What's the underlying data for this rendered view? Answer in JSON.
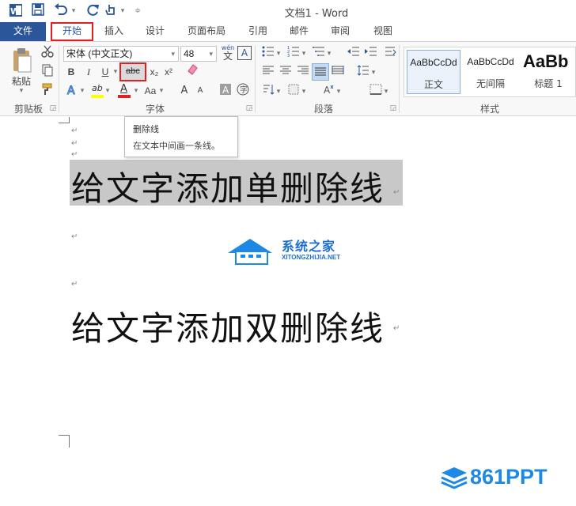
{
  "window": {
    "title": "文档1 - Word"
  },
  "quick_access": [
    "word-logo-icon",
    "save-icon",
    "undo-icon",
    "redo-icon",
    "touch-mode-icon",
    "customize-icon"
  ],
  "tabs": [
    "文件",
    "开始",
    "插入",
    "设计",
    "页面布局",
    "引用",
    "邮件",
    "审阅",
    "视图"
  ],
  "clipboard": {
    "paste_label": "粘贴",
    "group_label": "剪贴板"
  },
  "font": {
    "name": "宋体 (中文正文)",
    "size": "48",
    "wen_label": "wén",
    "wen_char": "文",
    "a_label": "A",
    "bold": "B",
    "italic": "I",
    "underline": "U",
    "strike": "abc",
    "sub": "x₂",
    "sup": "x²",
    "grow": "A",
    "shrink": "A",
    "case": "Aa",
    "ab": "ab",
    "font_color": "A",
    "group_label": "字体"
  },
  "paragraph": {
    "group_label": "段落"
  },
  "styles": {
    "items": [
      {
        "sample": "AaBbCcDd",
        "name": "正文"
      },
      {
        "sample": "AaBbCcDd",
        "name": "无间隔"
      },
      {
        "sample": "AaBb",
        "name": "标题 1"
      }
    ],
    "group_label": "样式"
  },
  "tooltip": {
    "title": "删除线",
    "description": "在文本中间画一条线。"
  },
  "document": {
    "line1": "给文字添加单删除线",
    "line2": "给文字添加双删除线",
    "watermark_cn": "系统之家",
    "watermark_en": "XITONGZHIJIA.NET",
    "logo_text": "861PPT"
  },
  "colors": {
    "accent": "#2b579a",
    "highlight_red": "#e21f26",
    "selection_gray": "#c8c8c8",
    "watermark_blue": "#1e88e5"
  }
}
